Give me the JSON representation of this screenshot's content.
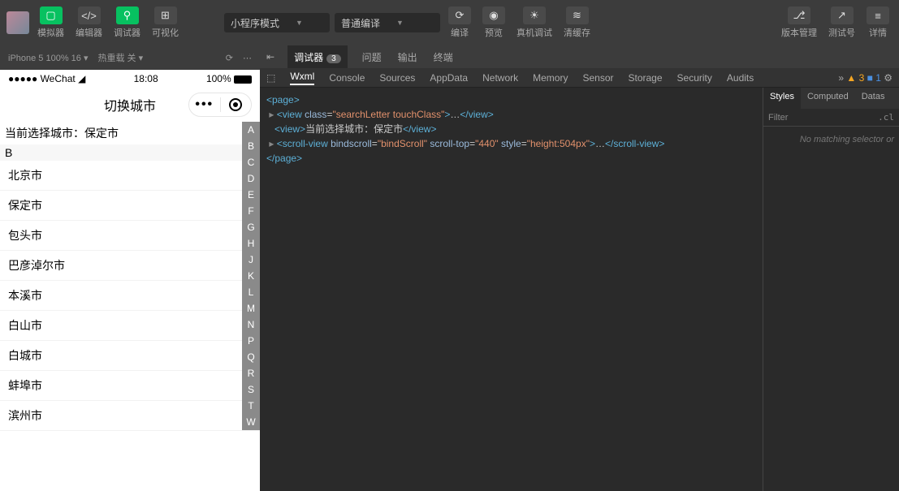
{
  "toolbar": {
    "simulator": "模拟器",
    "editor": "编辑器",
    "debugger": "调试器",
    "visualize": "可视化",
    "mode_dropdown": "小程序模式",
    "compile_dropdown": "普通编译",
    "compile": "编译",
    "preview": "预览",
    "real_debug": "真机调试",
    "clear_cache": "清缓存",
    "version": "版本管理",
    "test": "测试号",
    "detail": "详情"
  },
  "simhead": {
    "device": "iPhone 5 100% 16 ▾",
    "hotreload": "热重载 关 ▾"
  },
  "phone": {
    "carrier": "●●●●● WeChat",
    "time": "18:08",
    "battery": "100%",
    "title": "切换城市",
    "current_label": "当前选择城市：保定市",
    "section": "B",
    "cities": [
      "北京市",
      "保定市",
      "包头市",
      "巴彦淖尔市",
      "本溪市",
      "白山市",
      "白城市",
      "蚌埠市",
      "滨州市"
    ],
    "index": [
      "A",
      "B",
      "C",
      "D",
      "E",
      "F",
      "G",
      "H",
      "J",
      "K",
      "L",
      "M",
      "N",
      "P",
      "Q",
      "R",
      "S",
      "T",
      "W"
    ]
  },
  "devtabs": {
    "debugger": "调试器",
    "badge": "3",
    "problems": "问题",
    "output": "输出",
    "terminal": "终端"
  },
  "panels": [
    "Wxml",
    "Console",
    "Sources",
    "AppData",
    "Network",
    "Memory",
    "Sensor",
    "Storage",
    "Security",
    "Audits"
  ],
  "panel_warn": "3",
  "panel_info": "1",
  "code": {
    "l1": "<page>",
    "l2_tag": "view",
    "l2_attr": "class",
    "l2_val": "searchLetter touchClass",
    "l3_tag": "view",
    "l3_txt": "当前选择城市：保定市",
    "l4_tag": "scroll-view",
    "l4_a1": "bindscroll",
    "l4_v1": "bindScroll",
    "l4_a2": "scroll-top",
    "l4_v2": "440",
    "l4_a3": "style",
    "l4_v3": "height:504px",
    "l5": "</page>"
  },
  "side": {
    "styles": "Styles",
    "computed": "Computed",
    "dataset": "Datas",
    "filter": "Filter",
    "cls": ".cl",
    "msg": "No matching selector or"
  }
}
